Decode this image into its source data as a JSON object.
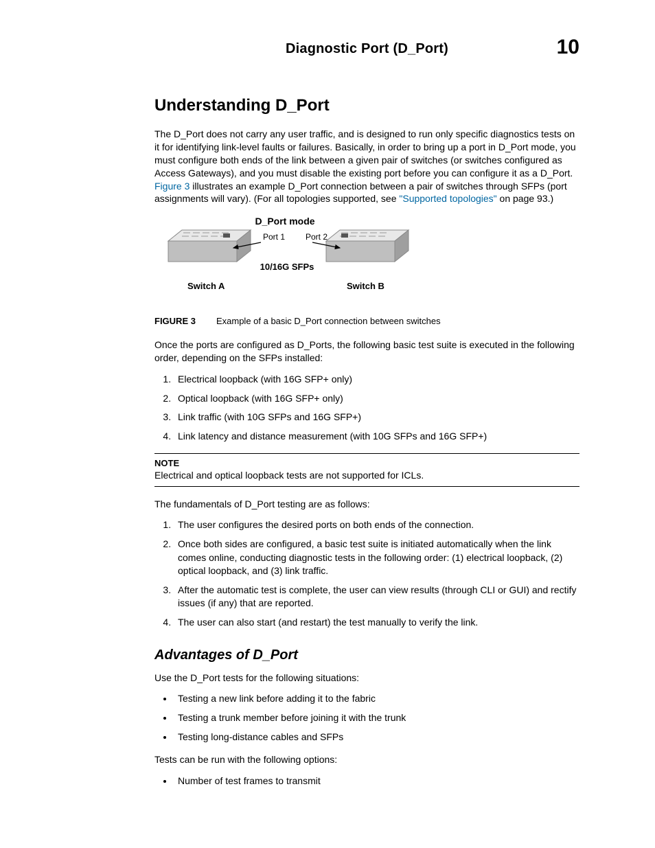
{
  "header": {
    "title": "Diagnostic Port (D_Port)",
    "chapter_num": "10"
  },
  "s1": {
    "heading": "Understanding D_Port",
    "para1_a": "The D_Port does not carry any user traffic, and is designed to run only specific diagnostics tests on it for identifying link-level faults or failures. Basically, in order to bring up a port in D_Port mode, you must configure both ends of the link between a given pair of switches (or switches configured as Access Gateways), and you must disable the existing port before you can configure it as a D_Port. ",
    "para1_link1": "Figure 3",
    "para1_b": " illustrates an example D_Port connection between a pair of switches through SFPs (port assignments will vary). (For all topologies supported, see ",
    "para1_link2": "\"Supported topologies\"",
    "para1_c": " on page 93.)"
  },
  "figure": {
    "mode_label": "D_Port mode",
    "port1": "Port 1",
    "port2": "Port 2",
    "sfps": "10/16G SFPs",
    "switchA": "Switch A",
    "switchB": "Switch B",
    "caption_label": "FIGURE 3",
    "caption_text": "Example of a basic D_Port connection between switches"
  },
  "s2": {
    "intro": "Once the ports are configured as D_Ports, the following basic test suite is executed in the following order, depending on the SFPs installed:",
    "items": [
      "Electrical loopback (with 16G SFP+ only)",
      "Optical loopback (with 16G SFP+ only)",
      "Link traffic (with 10G SFPs and 16G SFP+)",
      "Link latency and distance measurement (with 10G SFPs and 16G SFP+)"
    ]
  },
  "note": {
    "label": "NOTE",
    "text": "Electrical and optical loopback tests are not supported for ICLs."
  },
  "s3": {
    "intro": "The fundamentals of D_Port testing are as follows:",
    "items": [
      "The user configures the desired ports on both ends of the connection.",
      "Once both sides are configured, a basic test suite is initiated automatically when the link comes online, conducting diagnostic tests in the following order: (1) electrical loopback, (2) optical loopback, and (3) link traffic.",
      "After the automatic test is complete, the user can view results (through CLI or GUI) and rectify issues (if any) that are reported.",
      "The user can also start (and restart) the test manually to verify the link."
    ]
  },
  "s4": {
    "heading": "Advantages of D_Port",
    "intro": "Use the D_Port tests for the following situations:",
    "bullets1": [
      "Testing a new link before adding it to the fabric",
      "Testing a trunk member before joining it with the trunk",
      "Testing long-distance cables and SFPs"
    ],
    "mid": "Tests can be run with the following options:",
    "bullets2": [
      "Number of test frames to transmit"
    ]
  }
}
